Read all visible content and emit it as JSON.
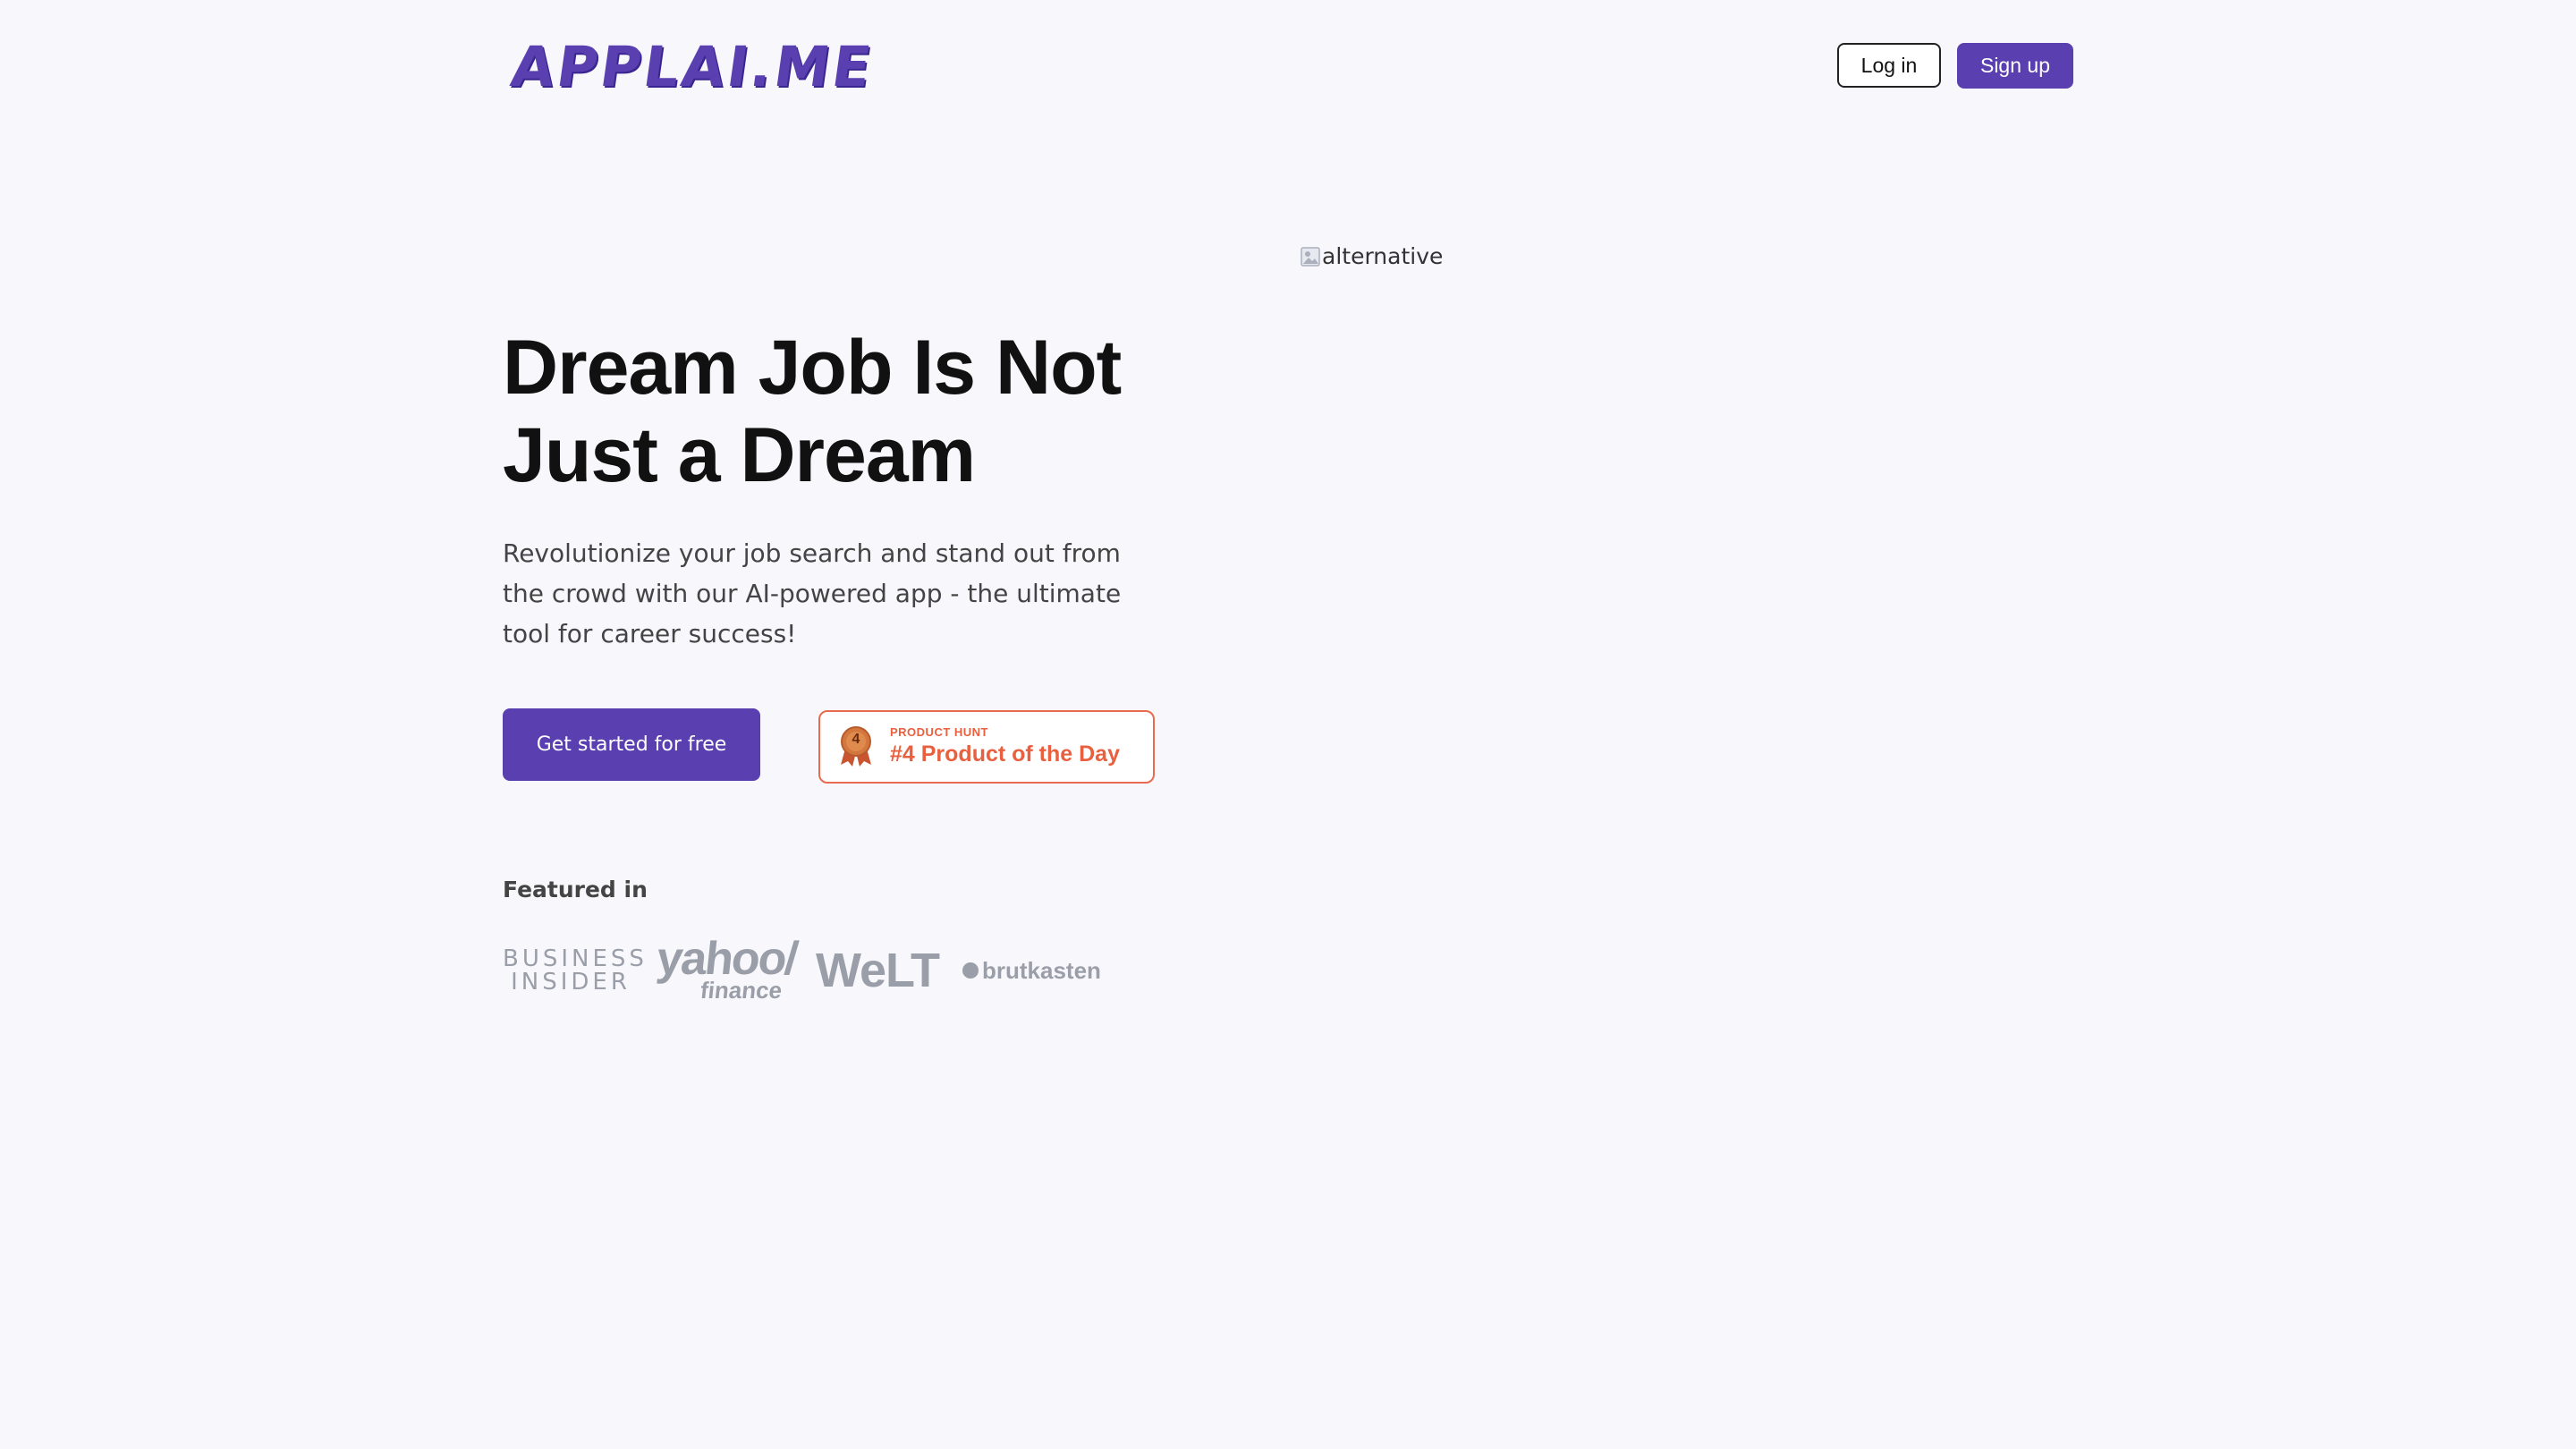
{
  "header": {
    "logo_text": "APPLAI.ME",
    "login_label": "Log in",
    "signup_label": "Sign up"
  },
  "hero": {
    "title_line1": "Dream Job Is Not",
    "title_line2": "Just a Dream",
    "subtitle": "Revolutionize your job search and stand out from the crowd with our AI-powered app - the ultimate tool for career success!",
    "cta_label": "Get started for free",
    "image_alt": "alternative"
  },
  "product_hunt": {
    "label": "PRODUCT HUNT",
    "title": "#4 Product of the Day",
    "rank": "4"
  },
  "featured": {
    "label": "Featured in",
    "logos": {
      "business_insider_line1": "BUSINESS",
      "business_insider_line2": "INSIDER",
      "yahoo_line1": "yahoo/",
      "yahoo_line2": "finance",
      "welt": "WeLT",
      "brutkasten": "brutkasten"
    }
  },
  "colors": {
    "brand": "#5a3fb0",
    "background": "#f8f8fc",
    "product_hunt": "#e8603f",
    "logo_gray": "#9a9ea8"
  }
}
